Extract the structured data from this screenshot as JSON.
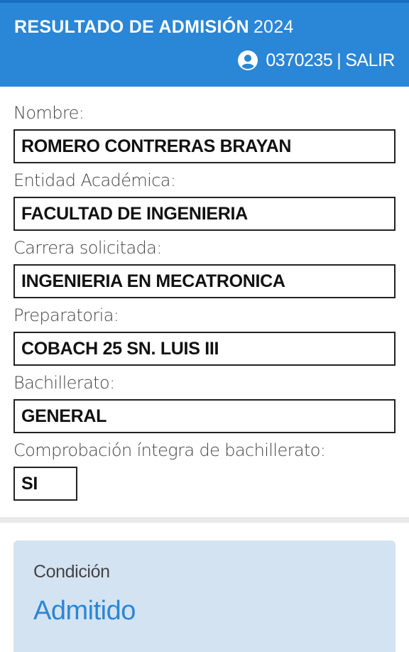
{
  "header": {
    "title": "RESULTADO DE ADMISIÓN",
    "year": "2024",
    "user_id": "0370235",
    "separator": "|",
    "logout_label": "SALIR",
    "bg_color": "#2a86d6"
  },
  "fields": [
    {
      "label": "Nombre:",
      "value": "ROMERO CONTRERAS BRAYAN"
    },
    {
      "label": "Entidad Académica:",
      "value": "FACULTAD DE INGENIERIA"
    },
    {
      "label": "Carrera solicitada:",
      "value": "INGENIERIA EN MECATRONICA"
    },
    {
      "label": "Preparatoria:",
      "value": "COBACH 25 SN. LUIS III"
    },
    {
      "label": "Bachillerato:",
      "value": "GENERAL"
    },
    {
      "label": "Comprobación íntegra de bachillerato:",
      "value": "SI"
    }
  ],
  "status": {
    "label": "Condición",
    "value": "Admitido",
    "card_color": "#d4e3f2",
    "value_color": "#2a86d6"
  }
}
